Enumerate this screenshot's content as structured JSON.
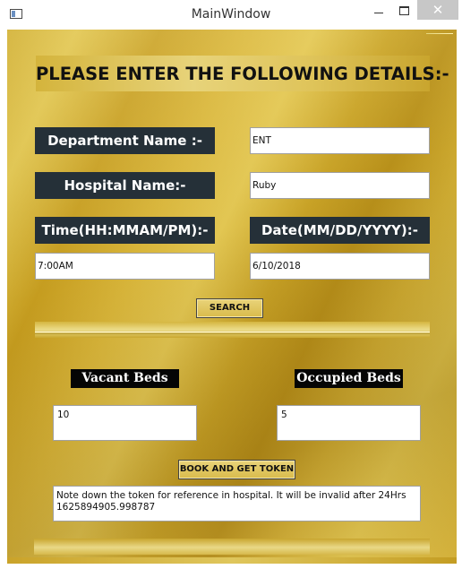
{
  "window": {
    "title": "MainWindow",
    "close_glyph": "✕"
  },
  "form": {
    "heading": "PLEASE ENTER THE FOLLOWING DETAILS:-",
    "department_label": "Department Name :-",
    "department_value": "ENT",
    "hospital_label": "Hospital Name:-",
    "hospital_value": "Ruby",
    "time_label": "Time(HH:MMAM/PM):-",
    "time_value": "7:00AM",
    "date_label": "Date(MM/DD/YYYY):-",
    "date_value": "6/10/2018",
    "search_button": "SEARCH"
  },
  "beds": {
    "vacant_label": "Vacant Beds",
    "vacant_value": "10",
    "occupied_label": "Occupied Beds",
    "occupied_value": "5"
  },
  "token": {
    "book_button": "BOOK AND GET TOKEN",
    "note": "Note down the token for reference in hospital. It will be invalid after 24Hrs\n1625894905.998787"
  }
}
